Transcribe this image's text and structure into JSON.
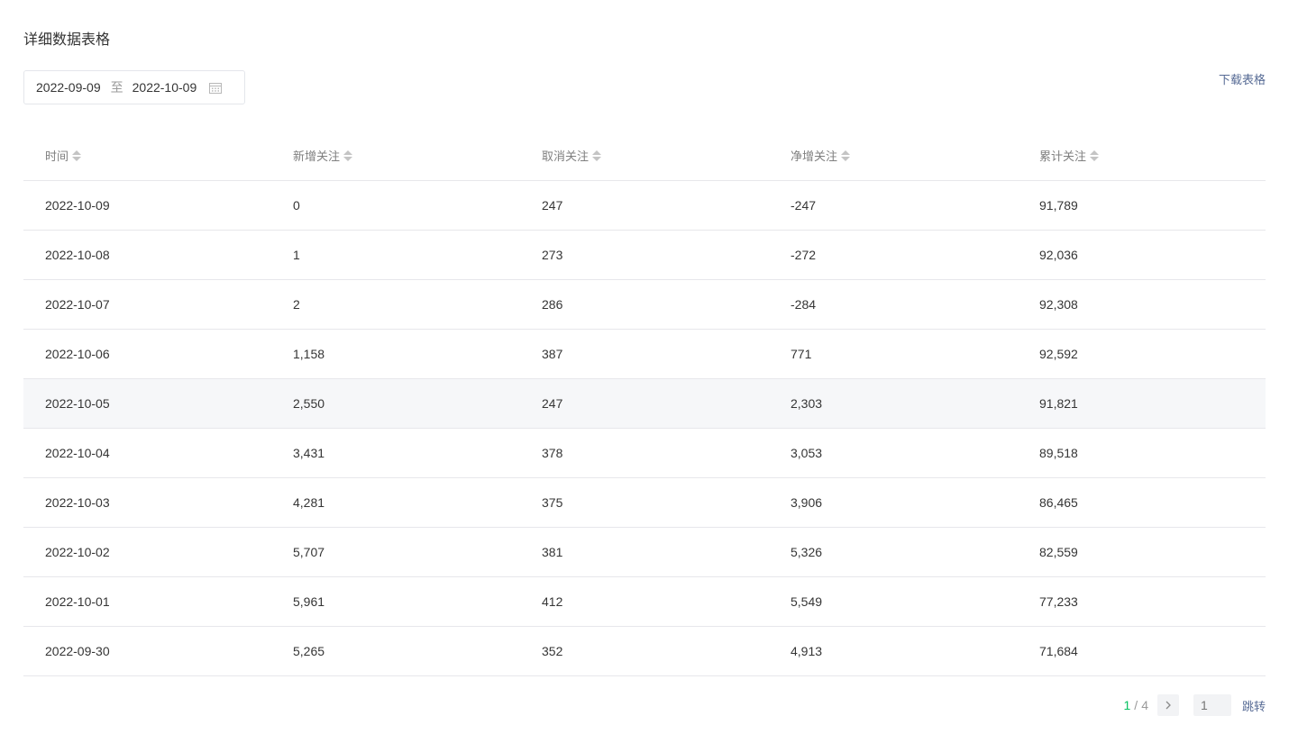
{
  "section_title": "详细数据表格",
  "date_range": {
    "start": "2022-09-09",
    "separator": "至",
    "end": "2022-10-09",
    "icon": "calendar-icon"
  },
  "download_label": "下载表格",
  "table": {
    "columns": [
      "时间",
      "新增关注",
      "取消关注",
      "净增关注",
      "累计关注"
    ],
    "rows": [
      [
        "2022-10-09",
        "0",
        "247",
        "-247",
        "91,789"
      ],
      [
        "2022-10-08",
        "1",
        "273",
        "-272",
        "92,036"
      ],
      [
        "2022-10-07",
        "2",
        "286",
        "-284",
        "92,308"
      ],
      [
        "2022-10-06",
        "1,158",
        "387",
        "771",
        "92,592"
      ],
      [
        "2022-10-05",
        "2,550",
        "247",
        "2,303",
        "91,821"
      ],
      [
        "2022-10-04",
        "3,431",
        "378",
        "3,053",
        "89,518"
      ],
      [
        "2022-10-03",
        "4,281",
        "375",
        "3,906",
        "86,465"
      ],
      [
        "2022-10-02",
        "5,707",
        "381",
        "5,326",
        "82,559"
      ],
      [
        "2022-10-01",
        "5,961",
        "412",
        "5,549",
        "77,233"
      ],
      [
        "2022-09-30",
        "5,265",
        "352",
        "4,913",
        "71,684"
      ]
    ],
    "highlighted_row": 4
  },
  "pagination": {
    "current": "1",
    "separator": "/",
    "total": "4",
    "jump_placeholder": "1",
    "jump_label": "跳转"
  },
  "colors": {
    "accent_green": "#07c160",
    "link_blue": "#576b95"
  }
}
